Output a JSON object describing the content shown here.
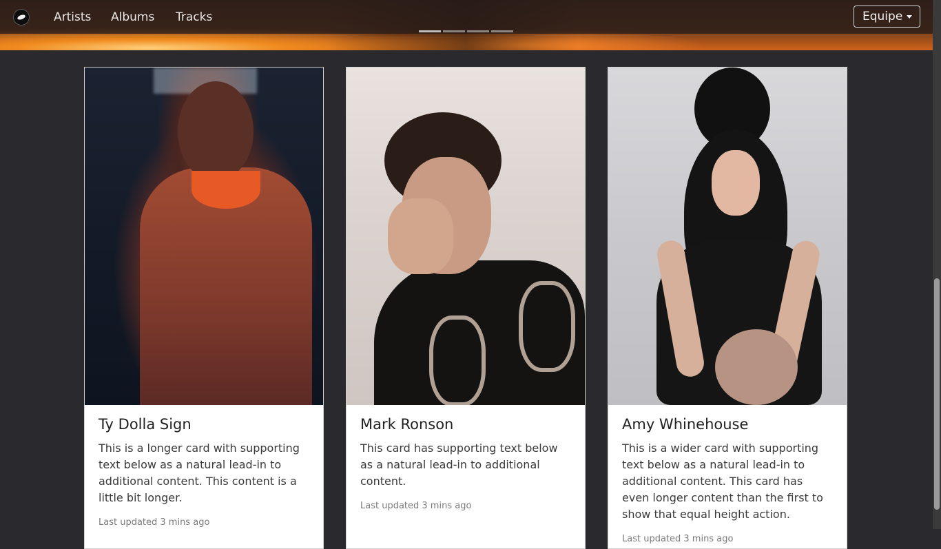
{
  "nav": {
    "links": [
      "Artists",
      "Albums",
      "Tracks"
    ],
    "dropdown_label": "Equipe"
  },
  "cards": [
    {
      "title": "Ty Dolla Sign",
      "text": "This is a longer card with supporting text below as a natural lead-in to additional content. This content is a little bit longer.",
      "updated": "Last updated 3 mins ago"
    },
    {
      "title": "Mark Ronson",
      "text": "This card has supporting text below as a natural lead-in to additional content.",
      "updated": "Last updated 3 mins ago"
    },
    {
      "title": "Amy Whinehouse",
      "text": "This is a wider card with supporting text below as a natural lead-in to additional content. This card has even longer content than the first to show that equal height action.",
      "updated": "Last updated 3 mins ago"
    }
  ],
  "carousel": {
    "indicator_count": 4,
    "active_index": 0
  },
  "colors": {
    "page_bg": "#2a2a2e",
    "card_bg": "#ffffff"
  },
  "icons": {
    "logo": "vinyl-logo-icon",
    "dropdown": "caret-down-icon"
  }
}
